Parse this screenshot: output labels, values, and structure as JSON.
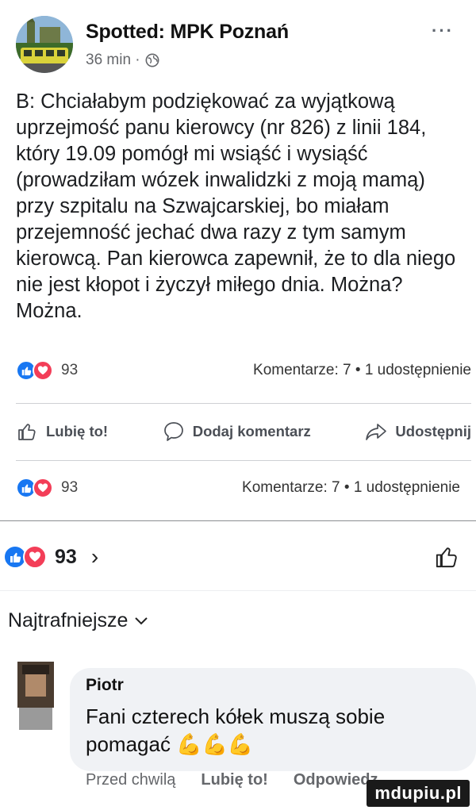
{
  "post": {
    "page_name": "Spotted: MPK Poznań",
    "time": "36 min ·",
    "text": "B: Chciałabym podziękować za wyjątkową uprzejmość panu kierowcy (nr 826) z linii 184, który 19.09 pomógł mi wsiąść i wysiąść (prowadziłam wózek inwalidzki z moją mamą) przy szpitalu na Szwajcarskiej, bo miałam przejemność jechać dwa razy z tym samym kierowcą. Pan kierowca zapewnił, że to dla niego nie jest kłopot i życzył miłego dnia. Można? Można.",
    "more": "···"
  },
  "reactions": {
    "count": "93",
    "stats": "Komentarze: 7 • 1 udostępnienie"
  },
  "actions": {
    "like": "Lubię to!",
    "comment": "Dodaj komentarz",
    "share": "Udostępnij"
  },
  "big_reactions": {
    "count": "93",
    "chevron": "›"
  },
  "sort": {
    "label": "Najtrafniejsze",
    "chevron": "⌄"
  },
  "comment": {
    "author": "Piotr",
    "text": "Fani czterech kółek muszą sobie pomagać 💪💪💪",
    "time": "Przed chwilą",
    "like": "Lubię to!",
    "reply": "Odpowiedz"
  },
  "watermark": "mdupiu.pl",
  "colors": {
    "like_blue": "#1877f2",
    "love_red": "#f33e58",
    "bubble": "#f0f2f5"
  }
}
